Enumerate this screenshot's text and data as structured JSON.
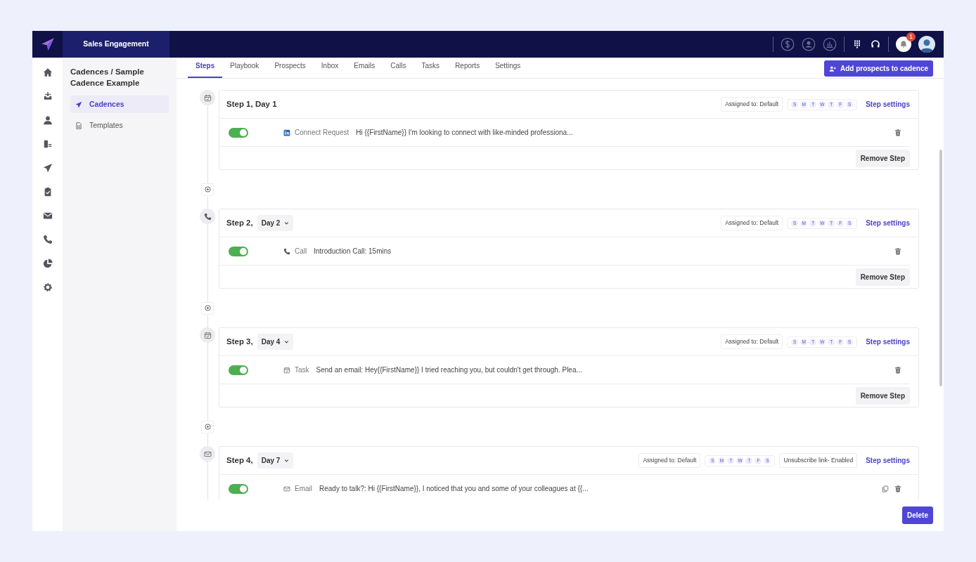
{
  "brand": {
    "title": "Sales Engagement"
  },
  "topbar": {
    "notification_count": "1"
  },
  "sidebar": {
    "breadcrumb": "Cadences / Sample Cadence Example",
    "items": [
      {
        "label": "Cadences",
        "kind": "cadences",
        "selected": true
      },
      {
        "label": "Templates",
        "kind": "templates",
        "selected": false
      }
    ]
  },
  "tabs": [
    {
      "label": "Steps",
      "selected": true
    },
    {
      "label": "Playbook",
      "selected": false
    },
    {
      "label": "Prospects",
      "selected": false
    },
    {
      "label": "Inbox",
      "selected": false
    },
    {
      "label": "Emails",
      "selected": false
    },
    {
      "label": "Calls",
      "selected": false
    },
    {
      "label": "Tasks",
      "selected": false
    },
    {
      "label": "Reports",
      "selected": false
    },
    {
      "label": "Settings",
      "selected": false
    }
  ],
  "add_button": "Add prospects to cadence",
  "steps": [
    {
      "title": "Step 1, Day 1",
      "assigned": "Assigned to: Default",
      "days": [
        "S",
        "M",
        "T",
        "W",
        "T",
        "F",
        "S"
      ],
      "settings_link": "Step settings",
      "remove_label": "Remove Step",
      "items": [
        {
          "kind": "linkedin",
          "on": true,
          "type_label": "Connect Request",
          "text": "Hi {{FirstName}} I'm looking to connect with like-minded professiona...",
          "copyable": false
        }
      ]
    },
    {
      "title": "Step 2,",
      "day": "Day 2",
      "assigned": "Assigned to: Default",
      "days": [
        "S",
        "M",
        "T",
        "W",
        "T",
        "F",
        "S"
      ],
      "settings_link": "Step settings",
      "remove_label": "Remove Step",
      "items": [
        {
          "kind": "call",
          "on": true,
          "type_label": "Call",
          "text": "Introduction Call: 15mins",
          "copyable": false
        }
      ]
    },
    {
      "title": "Step 3,",
      "day": "Day 4",
      "assigned": "Assigned to: Default",
      "days": [
        "S",
        "M",
        "T",
        "W",
        "T",
        "F",
        "S"
      ],
      "settings_link": "Step settings",
      "remove_label": "Remove Step",
      "items": [
        {
          "kind": "task",
          "on": true,
          "type_label": "Task",
          "text": "Send an email: Hey{{FirstName}} I tried reaching you, but couldn't get through. Plea...",
          "copyable": false
        }
      ]
    },
    {
      "title": "Step 4,",
      "day": "Day 7",
      "assigned": "Assigned to: Default",
      "days": [
        "S",
        "M",
        "T",
        "W",
        "T",
        "F",
        "S"
      ],
      "unsubscribe": "Unsubscribe link- Enabled",
      "settings_link": "Step settings",
      "items": [
        {
          "kind": "email",
          "on": true,
          "type_label": "Email",
          "text": "Ready to talk?: Hi {{FirstName}}, I noticed that you and some of your colleagues at {{...",
          "copyable": true
        }
      ]
    }
  ],
  "delete_button": "Delete"
}
